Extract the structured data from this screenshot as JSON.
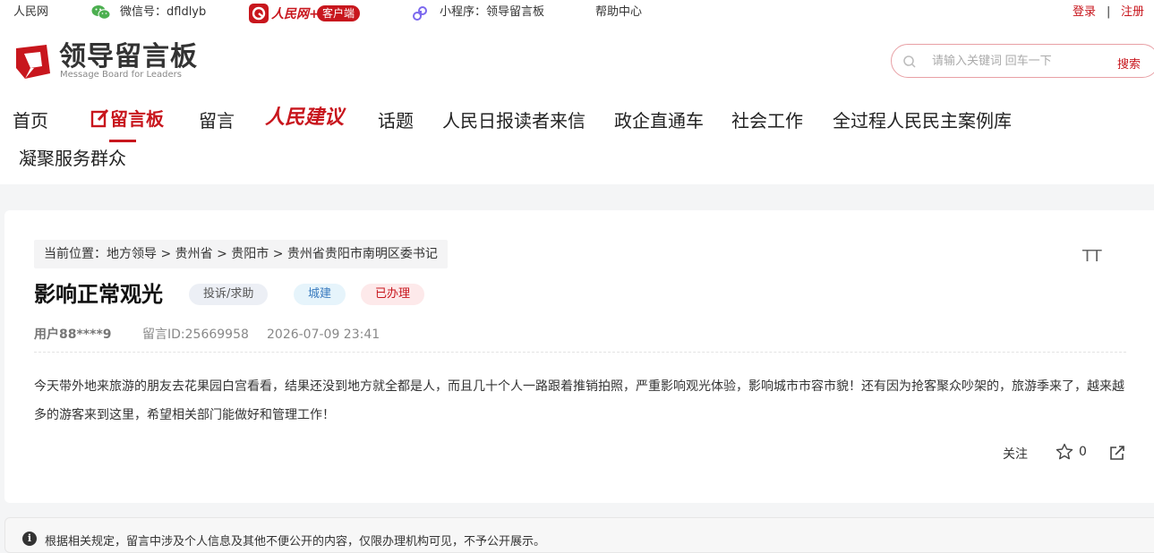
{
  "topbar": {
    "site": "人民网",
    "wechat": "微信号：dfldlyb",
    "app_logo_text": "人民网+",
    "app_badge": "客户端",
    "miniprogram": "小程序：领导留言板",
    "help": "帮助中心",
    "login": "登录",
    "separator": "|",
    "register": "注册"
  },
  "logo": {
    "cn": "领导留言板",
    "en": "Message Board for Leaders"
  },
  "search": {
    "placeholder": "请输入关键词 回车一下",
    "button": "搜索"
  },
  "nav": {
    "items": [
      "首页",
      "留言板",
      "留言",
      "人民建议",
      "话题",
      "人民日报读者来信",
      "政企直通车",
      "社会工作",
      "全过程人民民主案例库",
      "凝聚服务群众"
    ]
  },
  "breadcrumb": "当前位置：地方领导 > 贵州省 > 贵阳市 > 贵州省贵阳市南明区委书记",
  "post": {
    "title": "影响正常观光",
    "tags": [
      "投诉/求助",
      "城建",
      "已办理"
    ],
    "user": "用户88****9",
    "message_id": "留言ID:25669958",
    "datetime": "2026-07-09 23:41",
    "content": "今天带外地来旅游的朋友去花果园白宫看看，结果还没到地方就全都是人，而且几十个人一路跟着推销拍照，严重影响观光体验，影响城市市容市貌！还有因为抢客聚众吵架的，旅游季来了，越来越多的游客来到这里，希望相关部门能做好和管理工作！",
    "follow": "关注",
    "star_count": "0",
    "font_size_icon": "TT"
  },
  "notice": "根据相关规定，留言中涉及个人信息及其他不便公开的内容，仅限办理机构可见，不予公开展示。",
  "colors": {
    "brand_red": "#c8161d"
  }
}
